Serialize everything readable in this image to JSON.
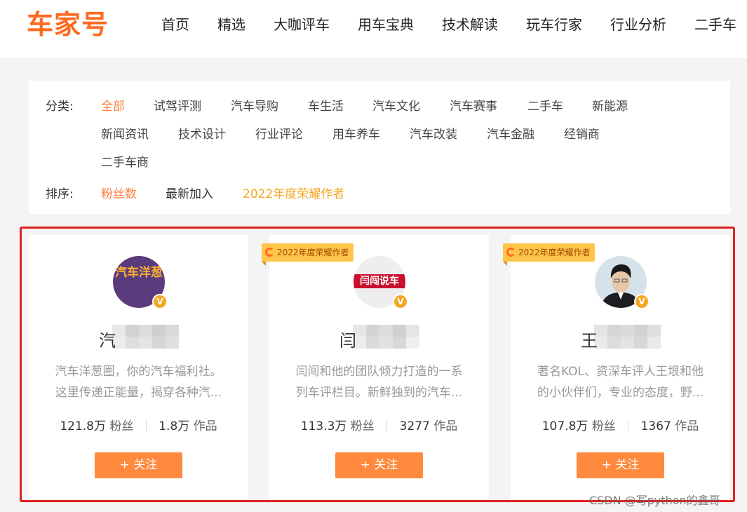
{
  "header": {
    "logo": "车家号",
    "nav": [
      "首页",
      "精选",
      "大咖评车",
      "用车宝典",
      "技术解读",
      "玩车行家",
      "行业分析",
      "二手车"
    ]
  },
  "filter": {
    "category_label": "分类:",
    "categories": [
      "全部",
      "试驾评测",
      "汽车导购",
      "车生活",
      "汽车文化",
      "汽车赛事",
      "二手车",
      "新能源",
      "新闻资讯",
      "技术设计",
      "行业评论",
      "用车养车",
      "汽车改装",
      "汽车金融",
      "经销商",
      "二手车商"
    ],
    "active_category": "全部",
    "sort_label": "排序:",
    "sorts": [
      "粉丝数",
      "最新加入",
      "2022年度荣耀作者"
    ]
  },
  "cards": [
    {
      "badge": "",
      "avatar_text": "汽车洋葱",
      "name_char": "汽",
      "desc": "汽车洋葱圈，你的汽车福利社。这里传递正能量，揭穿各种汽...",
      "fans": "121.8万",
      "fans_unit": "粉丝",
      "works": "1.8万",
      "works_unit": "作品",
      "follow": "+ 关注"
    },
    {
      "badge": "2022年度荣耀作者",
      "avatar_text": "闫闯说车",
      "name_char": "闫",
      "desc": "闫闯和他的团队倾力打造的一系列车评栏目。新鲜独到的汽车...",
      "fans": "113.3万",
      "fans_unit": "粉丝",
      "works": "3277",
      "works_unit": "作品",
      "follow": "+ 关注"
    },
    {
      "badge": "2022年度荣耀作者",
      "avatar_text": "",
      "name_char": "王",
      "desc": "著名KOL、资深车评人王垠和他的小伙伴们，专业的态度，野...",
      "fans": "107.8万",
      "fans_unit": "粉丝",
      "works": "1367",
      "works_unit": "作品",
      "follow": "+ 关注"
    }
  ],
  "watermark": "CSDN @写python的鑫哥"
}
